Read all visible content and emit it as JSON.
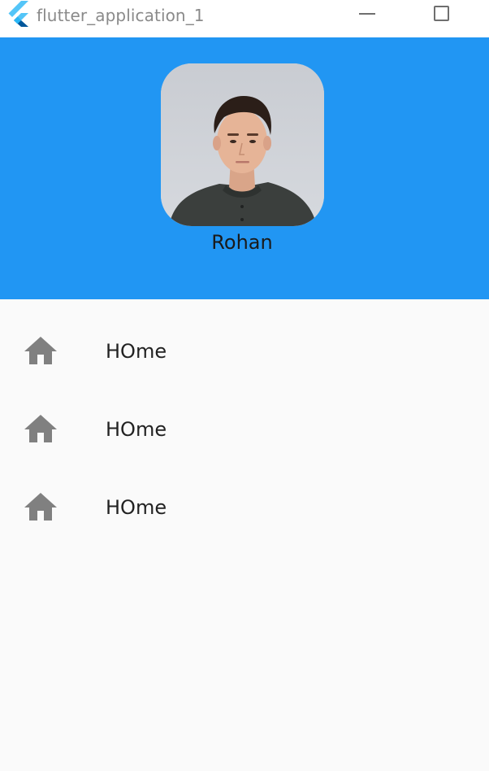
{
  "window": {
    "title": "flutter_application_1",
    "icons": {
      "app": "flutter-logo-icon",
      "minimize": "minimize-icon",
      "maximize": "maximize-icon"
    }
  },
  "drawer": {
    "header": {
      "background_color": "#2196f3",
      "avatar_icon": "profile-photo",
      "name": "Rohan"
    },
    "items": [
      {
        "icon": "home-icon",
        "label": "HOme"
      },
      {
        "icon": "home-icon",
        "label": "HOme"
      },
      {
        "icon": "home-icon",
        "label": "HOme"
      }
    ],
    "icon_color": "#808080"
  }
}
